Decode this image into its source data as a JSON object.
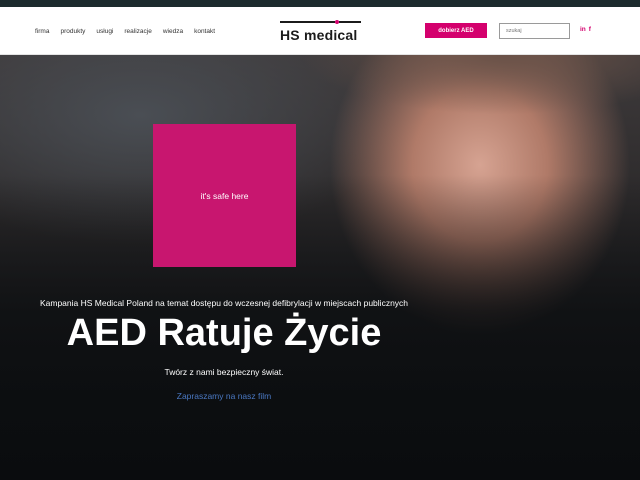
{
  "nav": {
    "links": [
      "firma",
      "produkty",
      "usługi",
      "realizacje",
      "wiedza",
      "kontakt"
    ]
  },
  "logo": {
    "text": "HS medical"
  },
  "header": {
    "aed_button": "dobierz AED",
    "search_placeholder": "szukaj",
    "social": {
      "instagram": "in",
      "facebook": "f"
    }
  },
  "hero": {
    "card_text": "it's safe here",
    "subtitle": "Kampania HS Medical Poland na temat dostępu do wczesnej defibrylacji w miejscach publicznych",
    "headline": "AED Ratuje Życie",
    "tagline": "Twórz z nami bezpieczny świat.",
    "film_link": "Zapraszamy na nasz film"
  },
  "colors": {
    "accent": "#d4006d",
    "card": "#c8166f",
    "link": "#4a78c2",
    "topstrip": "#1d2b2d"
  }
}
